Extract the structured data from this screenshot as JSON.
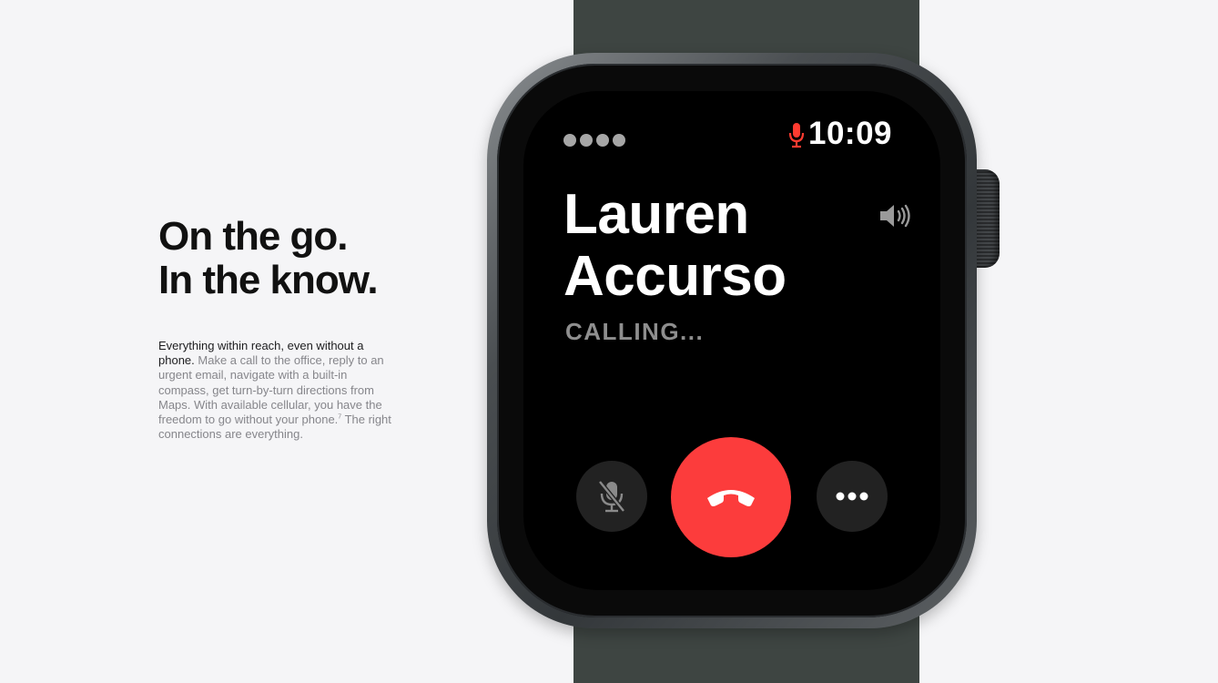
{
  "hero": {
    "headline_line1": "On the go.",
    "headline_line2": "In the know."
  },
  "copy": {
    "lead": "Everything within reach, even without a phone.",
    "body": "Make a call to the office, reply to an urgent email, navigate with a built-in compass, get turn-by-turn directions from Maps. With available cellular, you have the freedom to go without your phone.",
    "footnote": "7",
    "tail": "The right connections are everything."
  },
  "watch": {
    "time": "10:09",
    "caller_first": "Lauren",
    "caller_last": "Accurso",
    "call_status": "CALLING...",
    "signal_dots": 4,
    "icons": {
      "status": "microphone-icon",
      "speaker": "speaker-icon",
      "mute": "mute-microphone-icon",
      "end": "end-call-icon",
      "more": "ellipsis-icon"
    }
  },
  "colors": {
    "page_background": "#f5f5f7",
    "headline": "#111111",
    "body_text": "#86868b",
    "end_call": "#fc3c3c",
    "mic_indicator": "#ff3b30",
    "watch_band": "#3e4542"
  }
}
